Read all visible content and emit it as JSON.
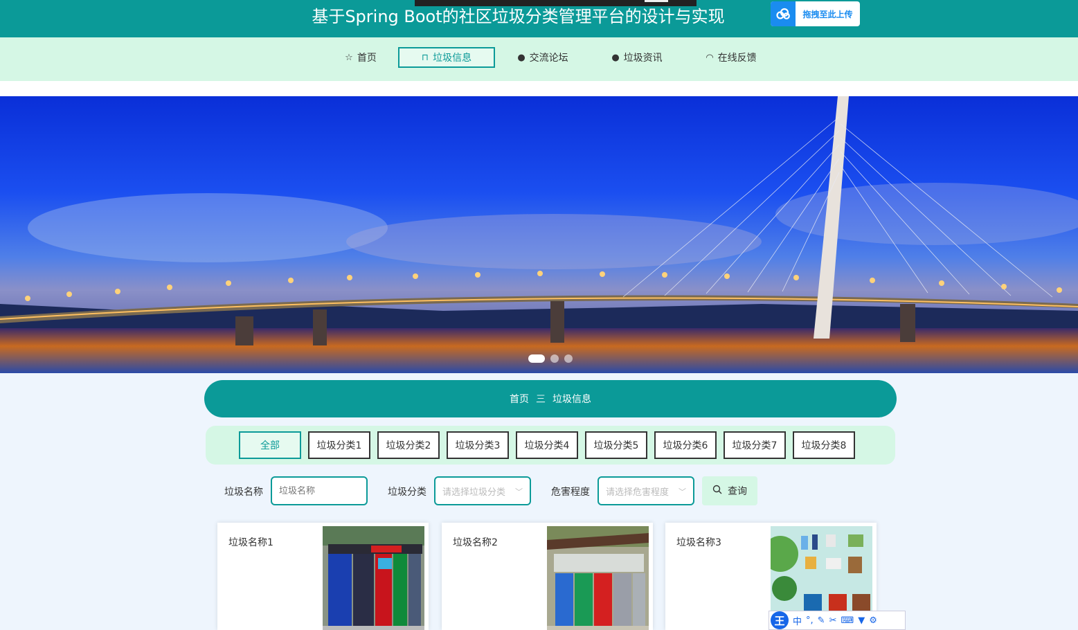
{
  "header": {
    "title": "基于Spring Boot的社区垃圾分类管理平台的设计与实现",
    "upload_label": "拖拽至此上传"
  },
  "nav": {
    "items": [
      {
        "label": "首页",
        "icon": "star-icon"
      },
      {
        "label": "垃圾信息",
        "icon": "bag-icon",
        "active": true
      },
      {
        "label": "交流论坛",
        "icon": "alert-icon"
      },
      {
        "label": "垃圾资讯",
        "icon": "question-icon"
      },
      {
        "label": "在线反馈",
        "icon": "headset-icon"
      }
    ]
  },
  "carousel": {
    "slide_count": 3,
    "active_index": 0
  },
  "breadcrumb": {
    "home": "首页",
    "separator": "三",
    "current": "垃圾信息"
  },
  "categories": [
    "全部",
    "垃圾分类1",
    "垃圾分类2",
    "垃圾分类3",
    "垃圾分类4",
    "垃圾分类5",
    "垃圾分类6",
    "垃圾分类7",
    "垃圾分类8"
  ],
  "search": {
    "name_label": "垃圾名称",
    "name_placeholder": "垃圾名称",
    "category_label": "垃圾分类",
    "category_placeholder": "请选择垃圾分类",
    "hazard_label": "危害程度",
    "hazard_placeholder": "请选择危害程度",
    "button_label": "查询"
  },
  "cards": [
    {
      "name": "垃圾名称1"
    },
    {
      "name": "垃圾名称2"
    },
    {
      "name": "垃圾名称3"
    }
  ],
  "ime": {
    "logo": "王",
    "mode": "中"
  },
  "colors": {
    "primary": "#0b9a98",
    "mint": "#d5f7e5",
    "page_bg": "#eef5fd"
  }
}
